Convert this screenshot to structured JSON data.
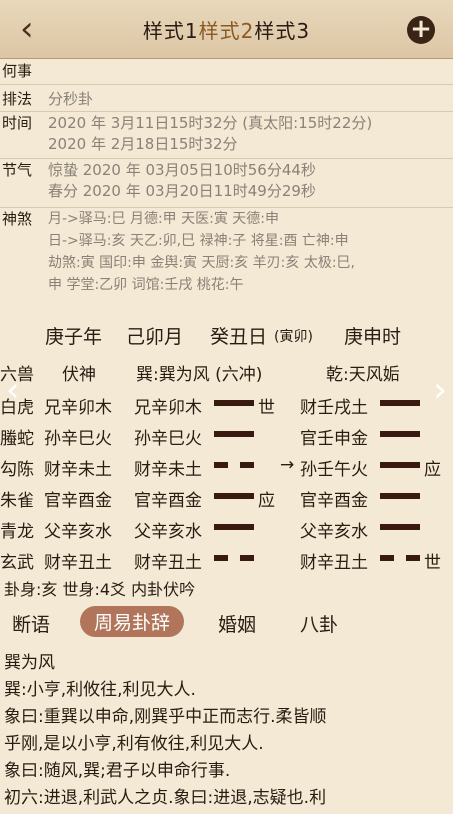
{
  "header": {
    "back": "‹",
    "tab1": "样式1",
    "tab2": "样式2",
    "tab3": "样式3",
    "plus": "+"
  },
  "info": {
    "heshi_label": "何事",
    "heshi_value": "",
    "paifa_label": "排法",
    "paifa_value": "分秒卦",
    "shijian_label": "时间",
    "shijian_1": "2020 年 3月11日15时32分 (真太阳:15时22分)",
    "shijian_2": "2020 年 2月18日15时32分",
    "jieqi_label": "节气",
    "jieqi_1": "惊蛰 2020 年 03月05日10时56分44秒",
    "jieqi_2": "春分 2020 年 03月20日11时49分29秒",
    "shensha_label": "神煞",
    "shensha_1": "月->驿马:巳 月德:甲 天医:寅 天德:申",
    "shensha_2": "日->驿马:亥 天乙:卯,巳 禄神:子 将星:酉 亡神:申",
    "shensha_3": "劫煞:寅 国印:申 金舆:寅 天厨:亥 羊刃:亥 太极:巳,",
    "shensha_4": "申 学堂:乙卯 词馆:壬戌 桃花:午"
  },
  "ganzhi": {
    "year": "庚子年",
    "month": "己卯月",
    "day": "癸丑日",
    "day_note": "(寅卯)",
    "hour": "庚申时"
  },
  "hexagram": {
    "head": {
      "liushou": "六兽",
      "fushen": "伏神",
      "main": "巽:巽为风 (六冲)",
      "changed": "乾:天风姤"
    },
    "rows": [
      {
        "shou": "白虎",
        "fu": "兄辛卯木",
        "ben": "兄辛卯木",
        "mark": "世",
        "bian": "财壬戌土",
        "bmark": ""
      },
      {
        "shou": "螣蛇",
        "fu": "孙辛巳火",
        "ben": "孙辛巳火",
        "mark": "",
        "bian": "官壬申金",
        "bmark": ""
      },
      {
        "shou": "勾陈",
        "fu": "财辛未土",
        "ben": "财辛未土",
        "mark": "→",
        "bian": "孙壬午火",
        "bmark": "应"
      },
      {
        "shou": "朱雀",
        "fu": "官辛酉金",
        "ben": "官辛酉金",
        "mark": "应",
        "bian": "官辛酉金",
        "bmark": ""
      },
      {
        "shou": "青龙",
        "fu": "父辛亥水",
        "ben": "父辛亥水",
        "mark": "",
        "bian": "父辛亥水",
        "bmark": ""
      },
      {
        "shou": "玄武",
        "fu": "财辛丑土",
        "ben": "财辛丑土",
        "mark": "",
        "bian": "财辛丑土",
        "bmark": "世"
      }
    ],
    "summary": "卦身:亥 世身:4爻 内卦伏吟"
  },
  "tabs2": {
    "t1": "断语",
    "t2": "周易卦辞",
    "t3": "婚姻",
    "t4": "八卦"
  },
  "text": {
    "l1": "巽为风",
    "l2": "巽:小亨,利攸往,利见大人.",
    "l3": "象曰:重巽以申命,刚巽乎中正而志行.柔皆顺",
    "l4": "乎刚,是以小亨,利有攸往,利见大人.",
    "l5": "象曰:随风,巽;君子以申命行事.",
    "l6": "初六:进退,利武人之贞.象曰:进退,志疑也.利"
  }
}
